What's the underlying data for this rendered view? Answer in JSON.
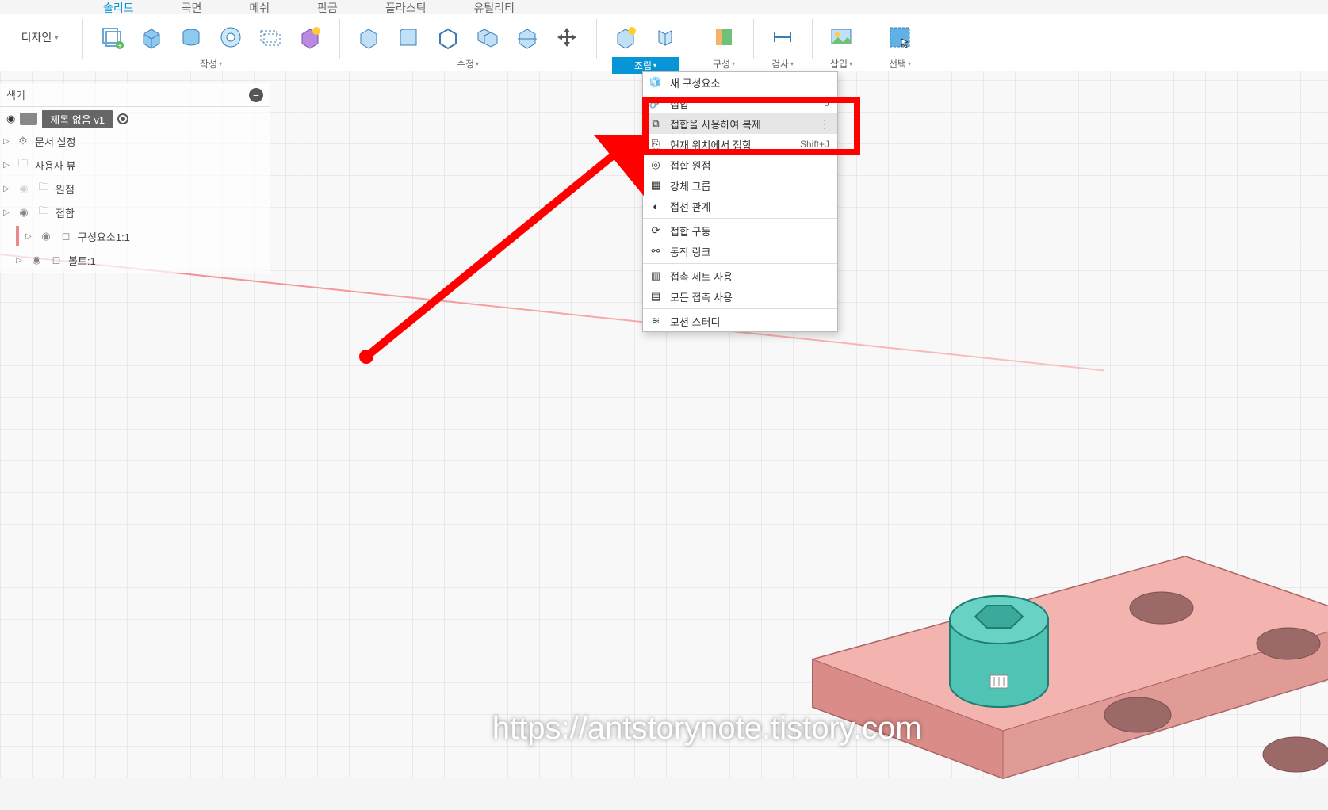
{
  "tabs": {
    "t0": "솔리드",
    "t1": "곡면",
    "t2": "메쉬",
    "t3": "판금",
    "t4": "플라스틱",
    "t5": "유틸리티"
  },
  "design_label": "디자인",
  "toolbar": {
    "create": "작성",
    "modify": "수정",
    "assemble": "조립",
    "construct": "구성",
    "inspect": "검사",
    "insert": "삽입",
    "select": "선택"
  },
  "browser": {
    "search_label": "색기",
    "doc_title": "제목 없음 v1",
    "items": {
      "doc_settings": "문서 설정",
      "user_views": "사용자 뷰",
      "origin": "원점",
      "joints": "접합",
      "component1": "구성요소1:1",
      "bolt1": "볼트:1"
    }
  },
  "menu": {
    "new_component": "새 구성요소",
    "joint": "접합",
    "joint_shortcut": "J",
    "pattern_joint": "접합을 사용하여 복제",
    "as_built_joint": "현재 위치에서 접합",
    "as_built_joint_shortcut": "Shift+J",
    "joint_origin": "접합 원점",
    "rigid_group": "강체 그룹",
    "tangent_rel": "접선 관계",
    "drive_joints": "접합 구동",
    "motion_link": "동작 링크",
    "enable_contact_sets": "접촉 세트 사용",
    "enable_all_contact": "모든 접촉 사용",
    "motion_study": "모션 스터디"
  },
  "watermark": "https://antstorynote.tistory.com"
}
